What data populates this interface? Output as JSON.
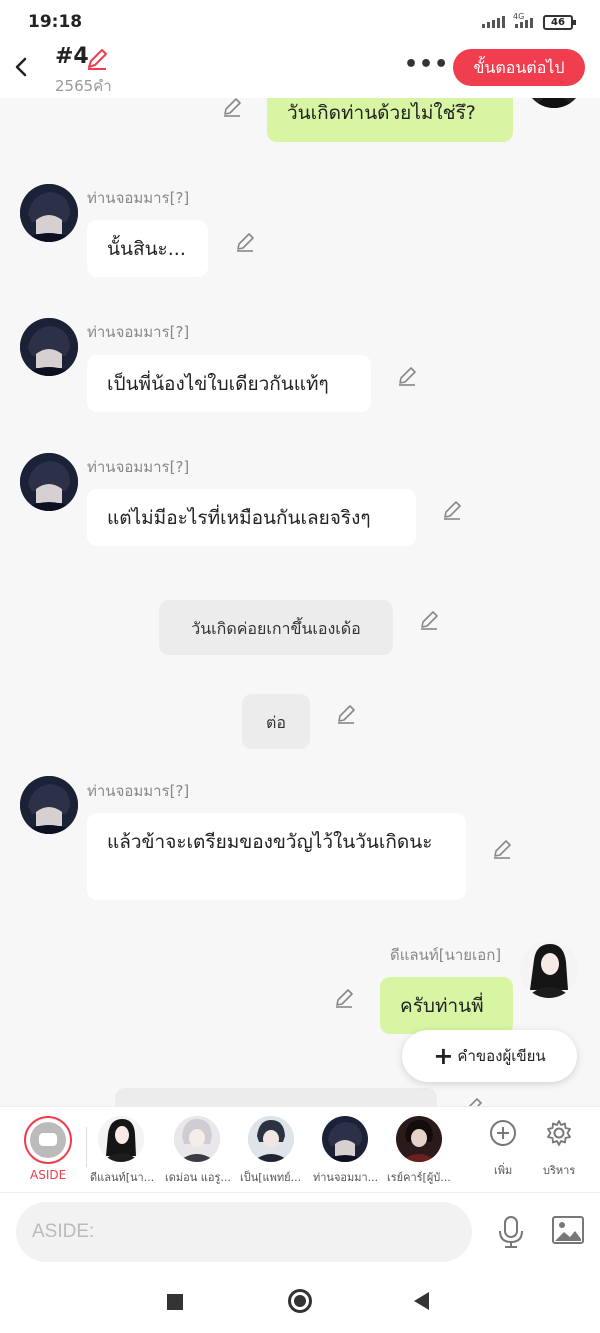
{
  "status": {
    "time": "19:18",
    "network": "4G",
    "battery": "46"
  },
  "header": {
    "title": "#4",
    "word_count": "2565คำ",
    "more": "•••",
    "next_button": "ขั้นตอนต่อไป"
  },
  "messages": [
    {
      "type": "right",
      "text": "วันเกิดท่านด้วยไม่ใช่รึ?"
    },
    {
      "type": "left",
      "name": "ท่านจอมมาร[?]",
      "text": "นั้นสินะ..."
    },
    {
      "type": "left",
      "name": "ท่านจอมมาร[?]",
      "text": "เป็นพี่น้องไข่ใบเดียวกันแท้ๆ"
    },
    {
      "type": "left",
      "name": "ท่านจอมมาร[?]",
      "text": "แต่ไม่มีอะไรที่เหมือนกันเลยจริงๆ"
    },
    {
      "type": "system",
      "text": "วันเกิดค่อยเกาขึ้นเองเด้อ"
    },
    {
      "type": "system",
      "text": "ต่อ"
    },
    {
      "type": "left",
      "name": "ท่านจอมมาร[?]",
      "text": "แล้วข้าจะเตรียมของขวัญไว้ในวันเกิดนะ"
    },
    {
      "type": "right",
      "name": "ดีแลนท์[นายเอก]",
      "text": "ครับท่านพี่"
    }
  ],
  "writer_button": "คำของผู้เขียน",
  "characters": {
    "aside": "ASIDE",
    "items": [
      {
        "label": "ดีแลนท์[นา..."
      },
      {
        "label": "เดม่อน แอรู..."
      },
      {
        "label": "เป็น[แพทย์..."
      },
      {
        "label": "ท่านจอมมา..."
      },
      {
        "label": "เรย์คาร์[ผู้บั..."
      }
    ],
    "add_label": "เพิ่ม",
    "manage_label": "บริหาร"
  },
  "input": {
    "placeholder": "ASIDE:"
  }
}
